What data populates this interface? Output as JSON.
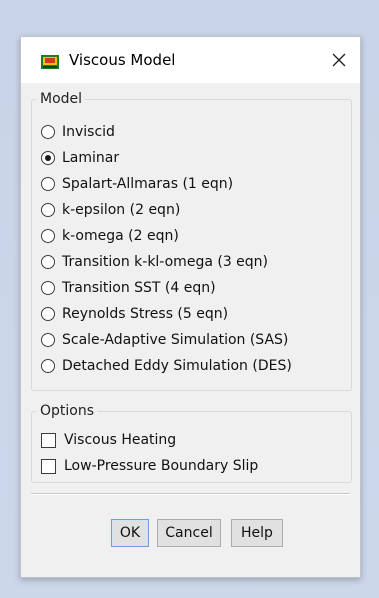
{
  "dialog": {
    "title": "Viscous Model",
    "icon": "fluent-app-icon",
    "close_icon": "close-icon"
  },
  "model_group": {
    "label": "Model",
    "options": [
      {
        "label": "Inviscid",
        "checked": false
      },
      {
        "label": "Laminar",
        "checked": true
      },
      {
        "label": "Spalart-Allmaras (1 eqn)",
        "checked": false
      },
      {
        "label": "k-epsilon (2 eqn)",
        "checked": false
      },
      {
        "label": "k-omega (2 eqn)",
        "checked": false
      },
      {
        "label": "Transition k-kl-omega (3 eqn)",
        "checked": false
      },
      {
        "label": "Transition SST (4 eqn)",
        "checked": false
      },
      {
        "label": "Reynolds Stress (5 eqn)",
        "checked": false
      },
      {
        "label": "Scale-Adaptive Simulation (SAS)",
        "checked": false
      },
      {
        "label": "Detached Eddy Simulation (DES)",
        "checked": false
      }
    ]
  },
  "options_group": {
    "label": "Options",
    "items": [
      {
        "label": "Viscous Heating",
        "checked": false
      },
      {
        "label": "Low-Pressure Boundary Slip",
        "checked": false
      }
    ]
  },
  "buttons": {
    "ok": "OK",
    "cancel": "Cancel",
    "help": "Help"
  },
  "colors": {
    "dialog_bg": "#f0f0f0",
    "desktop_bg": "#c9d4e8",
    "default_button_border": "#6ba0dc"
  }
}
